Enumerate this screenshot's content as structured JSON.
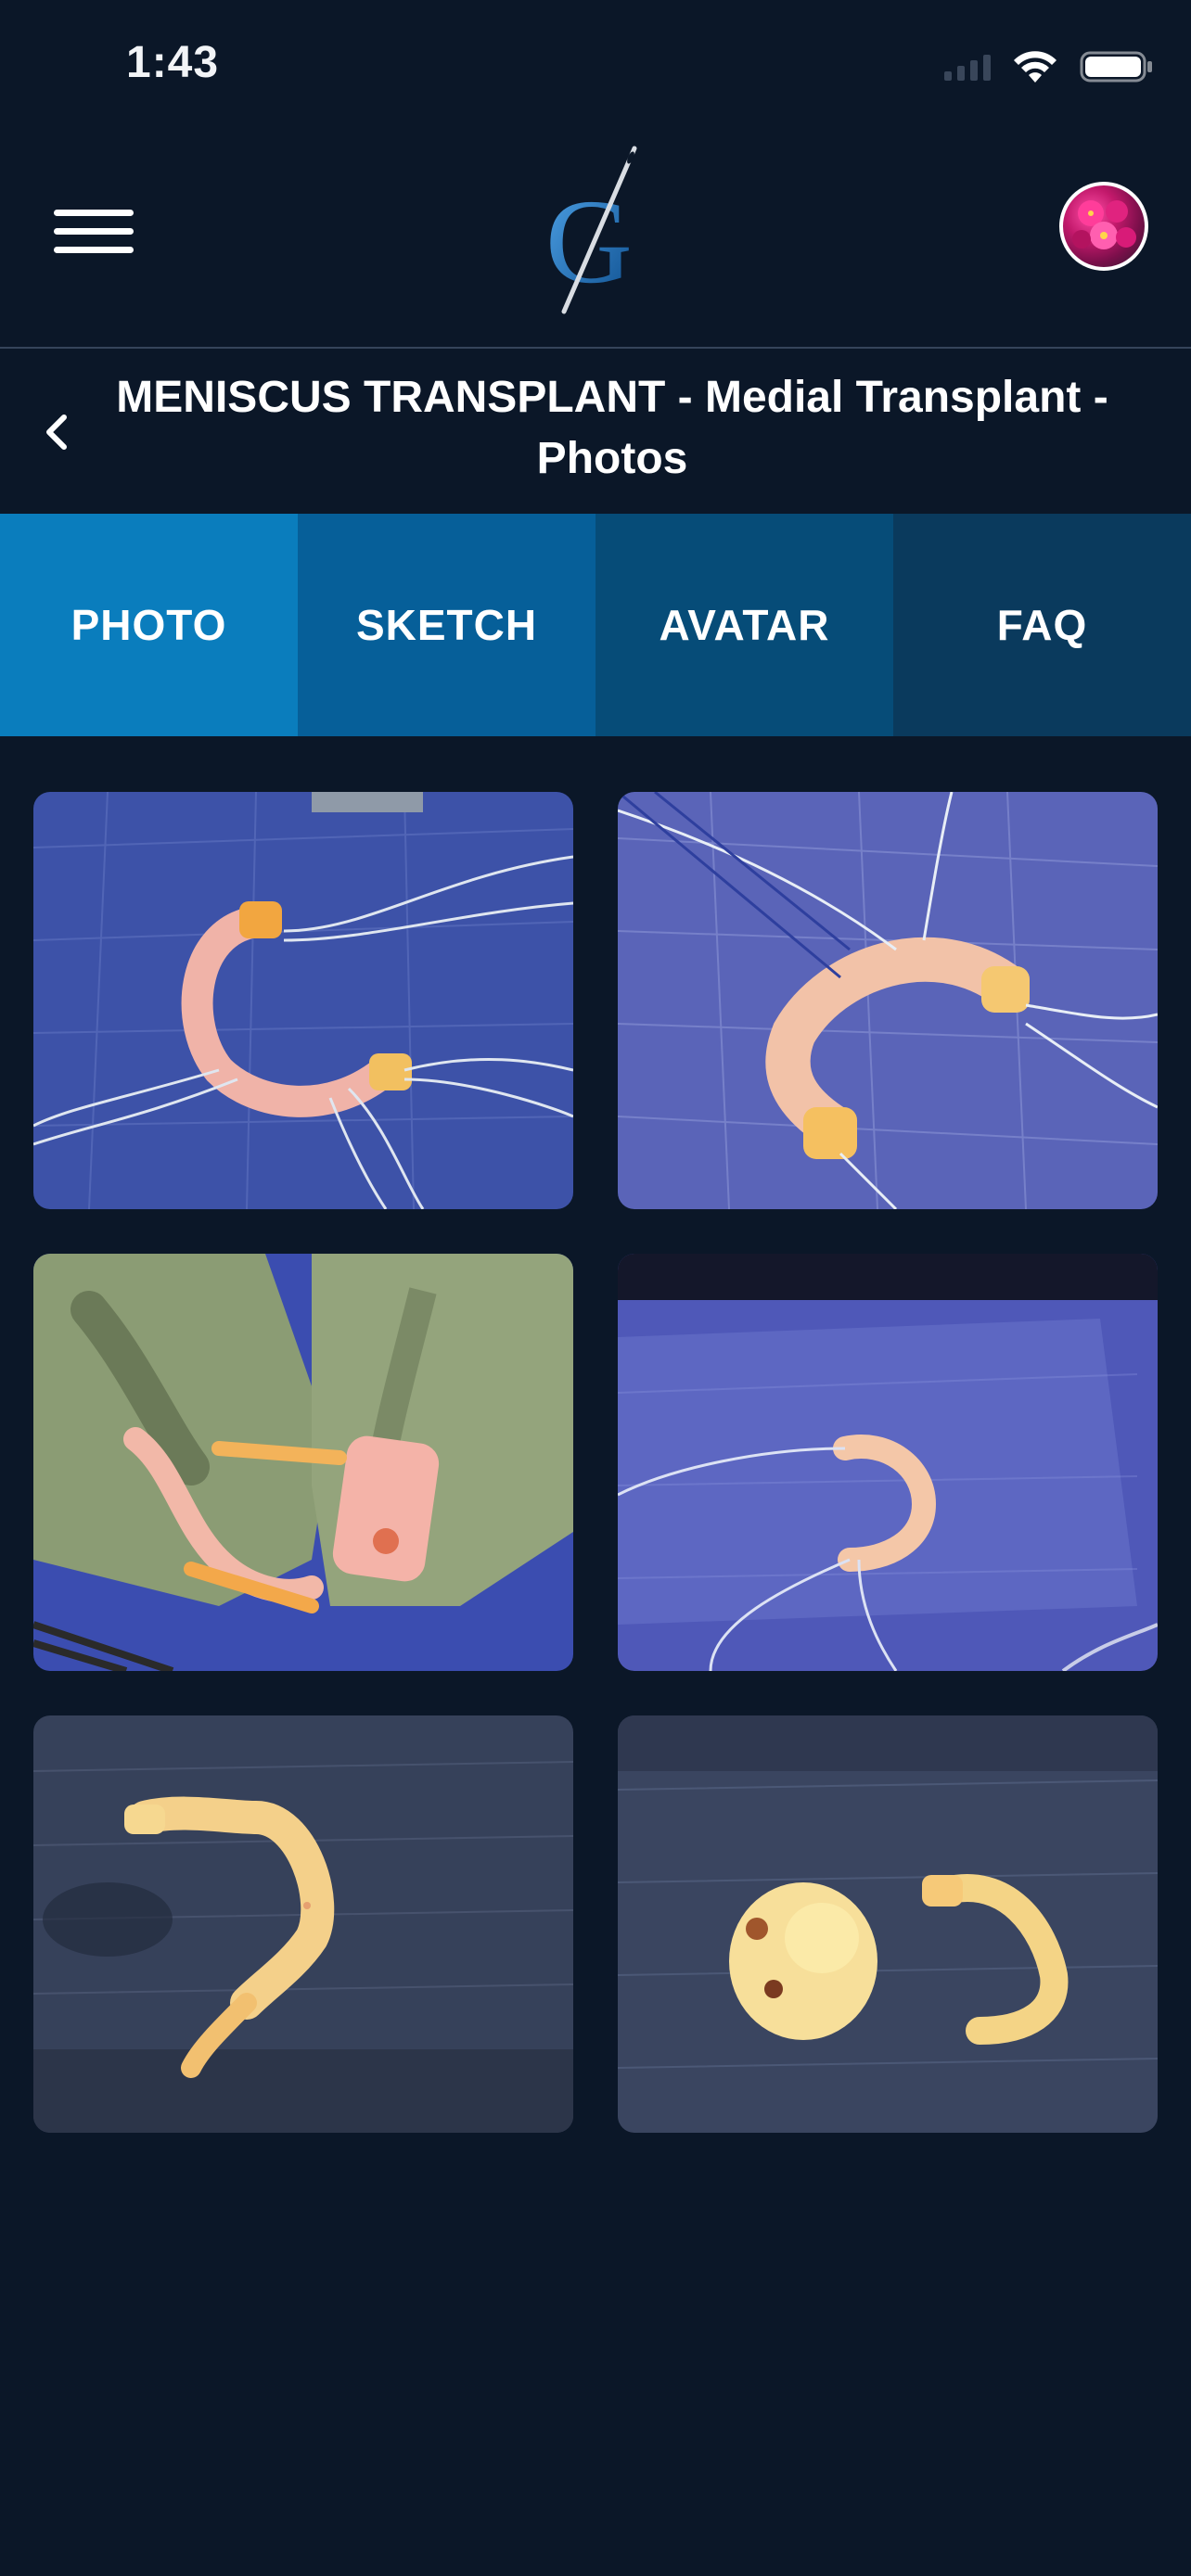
{
  "status_bar": {
    "time": "1:43"
  },
  "header": {
    "menu_icon": "hamburger-menu-icon",
    "logo_icon": "needle-g-logo-icon",
    "avatar_icon": "flower-avatar-icon"
  },
  "title_bar": {
    "back_icon": "chevron-left-icon",
    "title": "MENISCUS TRANSPLANT - Medial Transplant - Photos"
  },
  "tabs": [
    {
      "label": "PHOTO",
      "color": "#0a7dbd"
    },
    {
      "label": "SKETCH",
      "color": "#065f99"
    },
    {
      "label": "AVATAR",
      "color": "#064c78"
    },
    {
      "label": "FAQ",
      "color": "#0a3a5d"
    }
  ],
  "colors": {
    "background": "#0b1728",
    "divider": "#35445a"
  }
}
